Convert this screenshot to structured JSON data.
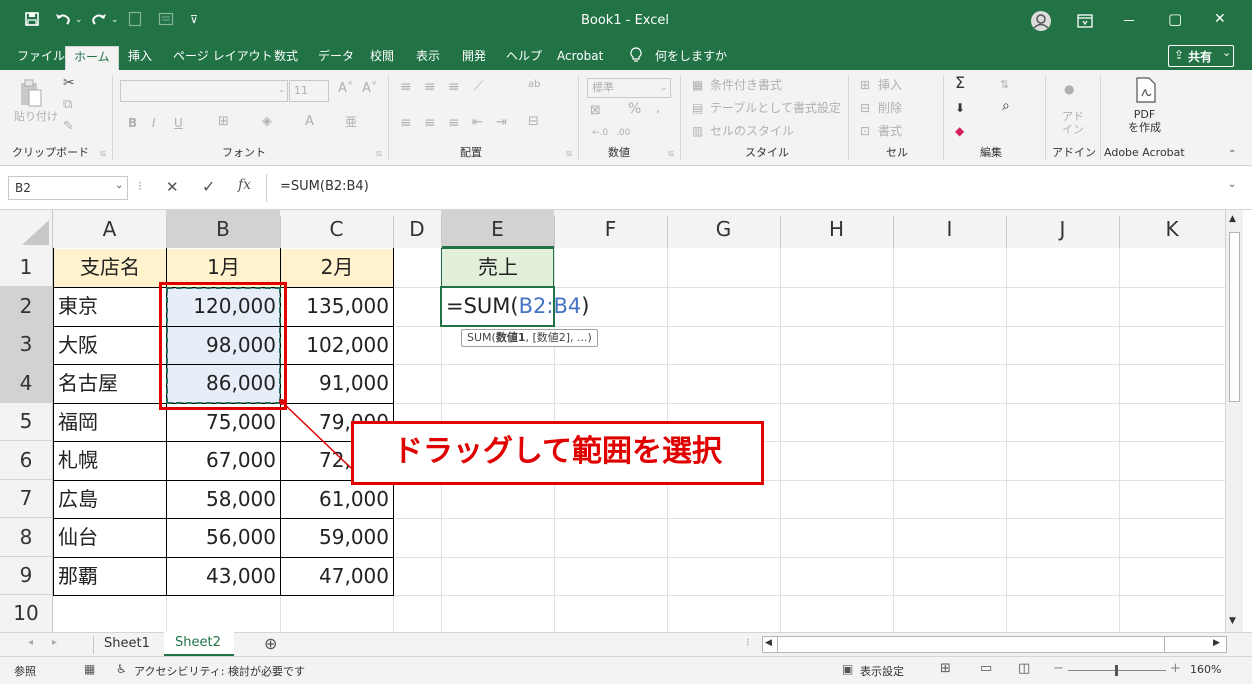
{
  "titlebar": {
    "title": "Book1  -  Excel",
    "save_icon": "save-icon",
    "undo_icon": "undo-icon",
    "redo_icon": "redo-icon",
    "account_icon": "account-icon",
    "ribbon_display_icon": "ribbon-display-icon",
    "minimize_glyph": "－",
    "maximize_glyph": "▢",
    "close_glyph": "✕",
    "accent": "#217346"
  },
  "menu": {
    "items": [
      "ファイル",
      "ホーム",
      "挿入",
      "ページ レイアウト",
      "数式",
      "データ",
      "校閲",
      "表示",
      "開発",
      "ヘルプ",
      "Acrobat"
    ],
    "search": "何をしますか",
    "share": "共有"
  },
  "ribbon": {
    "groups": [
      "クリップボード",
      "フォント",
      "配置",
      "数値",
      "スタイル",
      "セル",
      "編集",
      "アドイン",
      "Adobe Acrobat"
    ],
    "paste": "貼り付け",
    "font_size": "11",
    "number_format": "標準",
    "conditional_format": "条件付き書式",
    "table_format": "テーブルとして書式設定",
    "cell_styles": "セルのスタイル",
    "insert": "挿入",
    "delete": "削除",
    "format": "書式",
    "addins": "アド\nイン",
    "pdf": "PDF\nを作成"
  },
  "formulabar": {
    "name_box": "B2",
    "formula": "=SUM(B2:B4)"
  },
  "sheet": {
    "columns": [
      "A",
      "B",
      "C",
      "D",
      "E",
      "F",
      "G",
      "H",
      "I",
      "J",
      "K"
    ],
    "rows": [
      "1",
      "2",
      "3",
      "4",
      "5",
      "6",
      "7",
      "8",
      "9",
      "10"
    ],
    "headers": {
      "a1": "支店名",
      "b1": "1月",
      "c1": "2月"
    },
    "data": [
      {
        "branch": "東京",
        "jan": "120,000",
        "feb": "135,000"
      },
      {
        "branch": "大阪",
        "jan": "98,000",
        "feb": "102,000"
      },
      {
        "branch": "名古屋",
        "jan": "86,000",
        "feb": "91,000"
      },
      {
        "branch": "福岡",
        "jan": "75,000",
        "feb": "79,000"
      },
      {
        "branch": "札幌",
        "jan": "67,000",
        "feb": "72,000"
      },
      {
        "branch": "広島",
        "jan": "58,000",
        "feb": "61,000"
      },
      {
        "branch": "仙台",
        "jan": "56,000",
        "feb": "59,000"
      },
      {
        "branch": "那覇",
        "jan": "43,000",
        "feb": "47,000"
      }
    ],
    "e1": "売上",
    "e2_prefix": "=SUM(",
    "e2_ref": "B2:B4",
    "e2_suffix": ")",
    "tooltip_func": "SUM(",
    "tooltip_arg1": "数値1",
    "tooltip_rest": ", [数値2], ...)",
    "callout": "ドラッグして範囲を選択",
    "header_fill": "#fff2cc",
    "e1_fill": "#e2efda",
    "ref_color": "#4472c4",
    "callout_color": "#e00000"
  },
  "tabs": {
    "sheets": [
      "Sheet1",
      "Sheet2"
    ],
    "active": "Sheet2"
  },
  "status": {
    "mode": "参照",
    "accessibility": "アクセシビリティ: 検討が必要です",
    "display_settings": "表示設定",
    "zoom": "160%"
  }
}
